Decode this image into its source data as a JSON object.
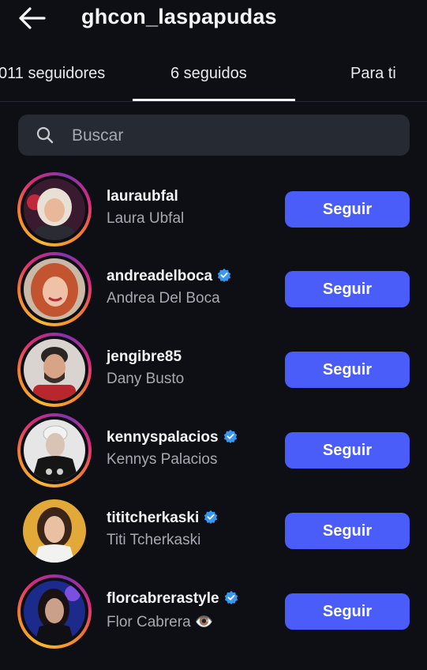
{
  "header": {
    "title": "ghcon_laspapudas",
    "back_icon": "arrow-left-icon"
  },
  "tabs": [
    {
      "label": "011 seguidores"
    },
    {
      "label": "6 seguidos",
      "active": true
    },
    {
      "label": "Para ti"
    }
  ],
  "search": {
    "placeholder": "Buscar",
    "icon": "search-icon"
  },
  "colors": {
    "accent": "#4a5df9",
    "background": "#0d0f14",
    "search_bg": "#262a33",
    "verified": "#3897f0"
  },
  "users": [
    {
      "username": "lauraubfal",
      "fullname": "Laura Ubfal",
      "verified": false,
      "story_ring": true,
      "button": "Seguir"
    },
    {
      "username": "andreadelboca",
      "fullname": "Andrea Del Boca",
      "verified": true,
      "story_ring": true,
      "button": "Seguir"
    },
    {
      "username": "jengibre85",
      "fullname": "Dany Busto",
      "verified": false,
      "story_ring": true,
      "button": "Seguir"
    },
    {
      "username": "kennyspalacios",
      "fullname": "Kennys Palacios",
      "verified": true,
      "story_ring": true,
      "button": "Seguir"
    },
    {
      "username": "tititcherkaski",
      "fullname": "Titi Tcherkaski",
      "verified": true,
      "story_ring": false,
      "button": "Seguir"
    },
    {
      "username": "florcabrerastyle",
      "fullname": "Flor Cabrera 👁️",
      "verified": true,
      "story_ring": true,
      "button": "Seguir"
    }
  ]
}
